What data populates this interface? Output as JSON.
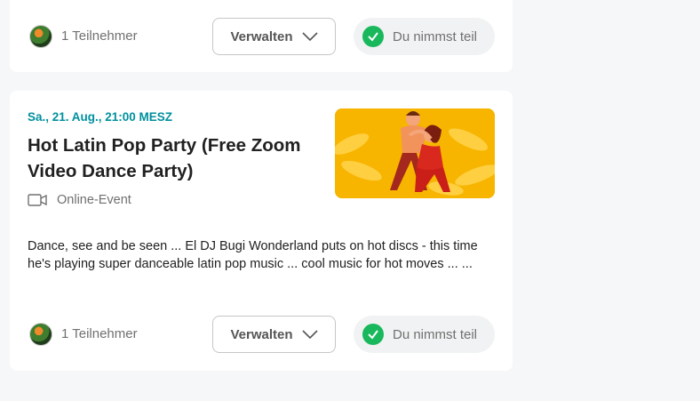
{
  "events": [
    {
      "attendees": "1 Teilnehmer",
      "manage_label": "Verwalten",
      "status_label": "Du nimmst teil"
    },
    {
      "date": "Sa., 21. Aug., 21:00 MESZ",
      "title": "Hot Latin Pop Party (Free Zoom Video Dance Party)",
      "venue": "Online-Event",
      "description": "Dance, see and be seen ... El DJ Bugi Wonderland puts on hot discs - this time he's playing super danceable latin pop music ... cool music for hot moves ... ...",
      "attendees": "1 Teilnehmer",
      "manage_label": "Verwalten",
      "status_label": "Du nimmst teil"
    }
  ],
  "colors": {
    "date_accent": "#00909e",
    "check_green": "#19b85c",
    "page_bg": "#f6f7f8"
  },
  "icons": [
    "video-camera-icon",
    "chevron-down-icon",
    "check-circle-icon"
  ]
}
